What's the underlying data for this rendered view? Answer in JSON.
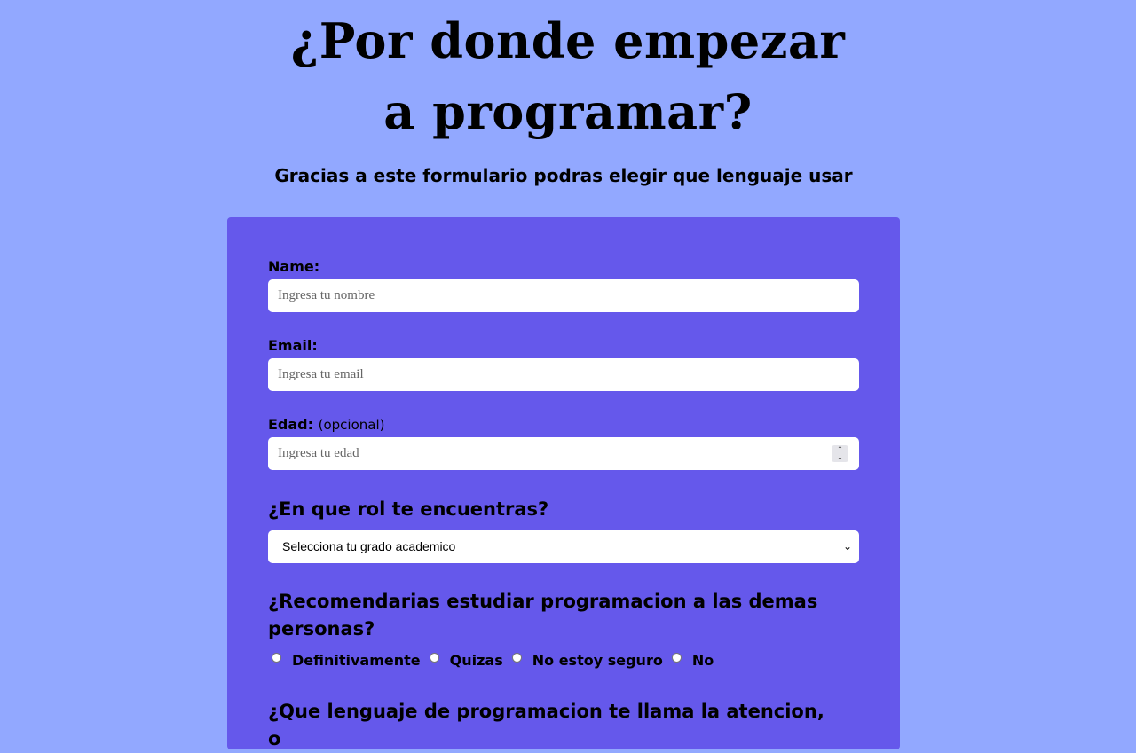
{
  "header": {
    "title": "¿Por donde empezar a programar?",
    "subtitle": "Gracias a este formulario podras elegir que lenguaje usar"
  },
  "form": {
    "name": {
      "label": "Name:",
      "placeholder": "Ingresa tu nombre"
    },
    "email": {
      "label": "Email:",
      "placeholder": "Ingresa tu email"
    },
    "age": {
      "label": "Edad:",
      "optional": "(opcional)",
      "placeholder": "Ingresa tu edad"
    },
    "role": {
      "question": "¿En que rol te encuentras?",
      "selected": "Selecciona tu grado academico"
    },
    "recommend": {
      "question": "¿Recomendarias estudiar programacion a las demas personas?",
      "options": [
        "Definitivamente",
        "Quizas",
        "No estoy seguro",
        "No"
      ]
    },
    "language": {
      "question": "¿Que lenguaje de programacion te llama la atencion, o"
    }
  },
  "colors": {
    "background": "#92a8ff",
    "card": "#6558eb"
  }
}
